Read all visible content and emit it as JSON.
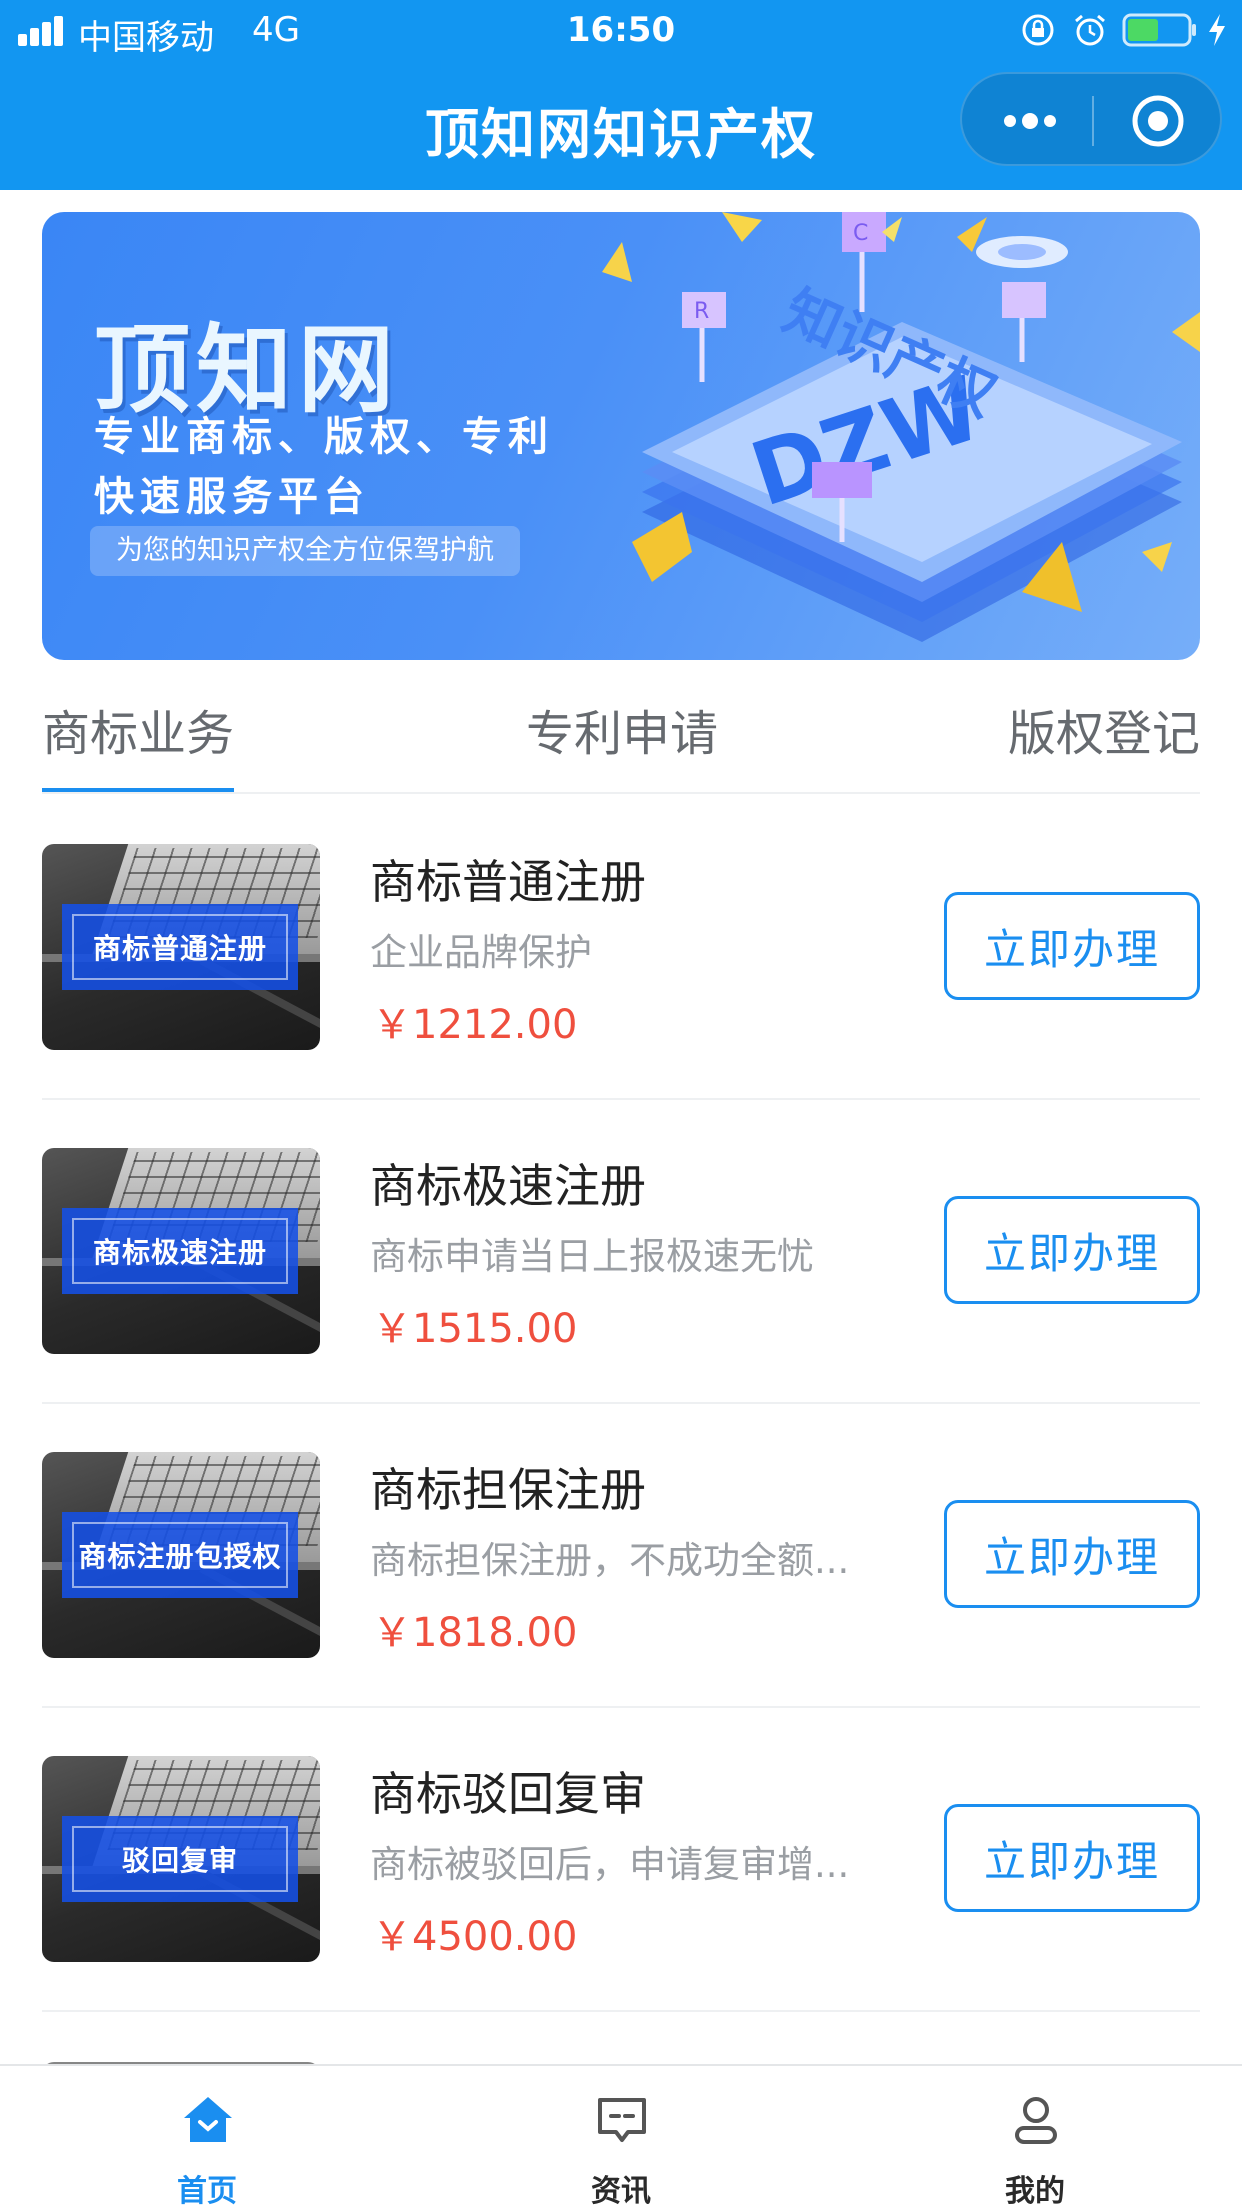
{
  "status_bar": {
    "carrier": "中国移动",
    "network": "4G",
    "time": "16:50",
    "battery_color": "#4cd964"
  },
  "header": {
    "title": "顶知网知识产权",
    "background": "#1296f1"
  },
  "banner": {
    "title": "顶知网",
    "line1": "专业商标、版权、专利",
    "line2": "快速服务平台",
    "tagline": "为您的知识产权全方位保驾护航"
  },
  "tabs": [
    {
      "label": "商标业务",
      "active": true
    },
    {
      "label": "专利申请",
      "active": false
    },
    {
      "label": "版权登记",
      "active": false
    }
  ],
  "products": [
    {
      "thumb_label": "商标普通注册",
      "title": "商标普通注册",
      "desc": "企业品牌保护",
      "price": "￥1212.00",
      "button": "立即办理"
    },
    {
      "thumb_label": "商标极速注册",
      "title": "商标极速注册",
      "desc": "商标申请当日上报极速无忧",
      "price": "￥1515.00",
      "button": "立即办理"
    },
    {
      "thumb_label": "商标注册包授权",
      "title": "商标担保注册",
      "desc": "商标担保注册，不成功全额...",
      "price": "￥1818.00",
      "button": "立即办理"
    },
    {
      "thumb_label": "驳回复审",
      "title": "商标驳回复审",
      "desc": "商标被驳回后，申请复审增...",
      "price": "￥4500.00",
      "button": "立即办理"
    }
  ],
  "tabbar": [
    {
      "label": "首页",
      "icon": "home-icon",
      "active": true
    },
    {
      "label": "资讯",
      "icon": "message-icon",
      "active": false
    },
    {
      "label": "我的",
      "icon": "user-icon",
      "active": false
    }
  ],
  "colors": {
    "accent": "#1a8ef0",
    "price": "#ef4f3e"
  }
}
